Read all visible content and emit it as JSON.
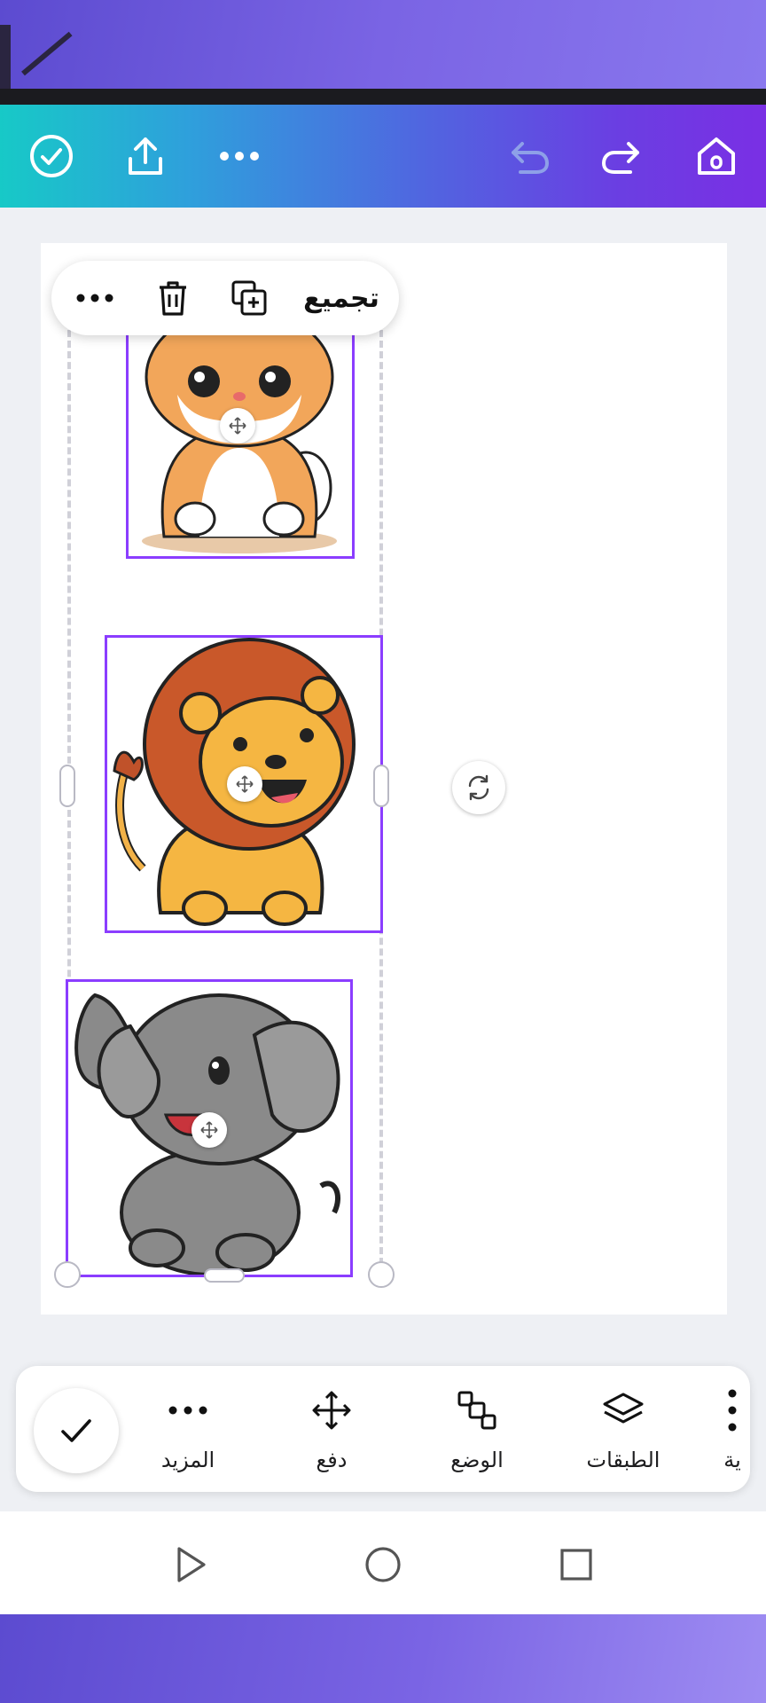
{
  "toolbar": {
    "icons": [
      "check-icon",
      "share-icon",
      "more-icon",
      "undo-icon",
      "redo-icon",
      "home-icon"
    ]
  },
  "floating_bar": {
    "group_label": "تجميع",
    "icons": [
      "more-icon",
      "delete-icon",
      "duplicate-icon"
    ]
  },
  "canvas": {
    "images": [
      "cat-illustration",
      "lion-illustration",
      "elephant-illustration"
    ]
  },
  "bottom_toolbar": {
    "tools": [
      {
        "label": "المزيد",
        "icon": "more-icon"
      },
      {
        "label": "دفع",
        "icon": "nudge-icon"
      },
      {
        "label": "الوضع",
        "icon": "position-icon"
      },
      {
        "label": "الطبقات",
        "icon": "layers-icon"
      },
      {
        "label": "ية",
        "icon": "more-vertical-icon"
      }
    ]
  },
  "colors": {
    "selection": "#8b3dff",
    "toolbar_gradient_start": "#17c9c7",
    "toolbar_gradient_end": "#7a2fe4"
  }
}
